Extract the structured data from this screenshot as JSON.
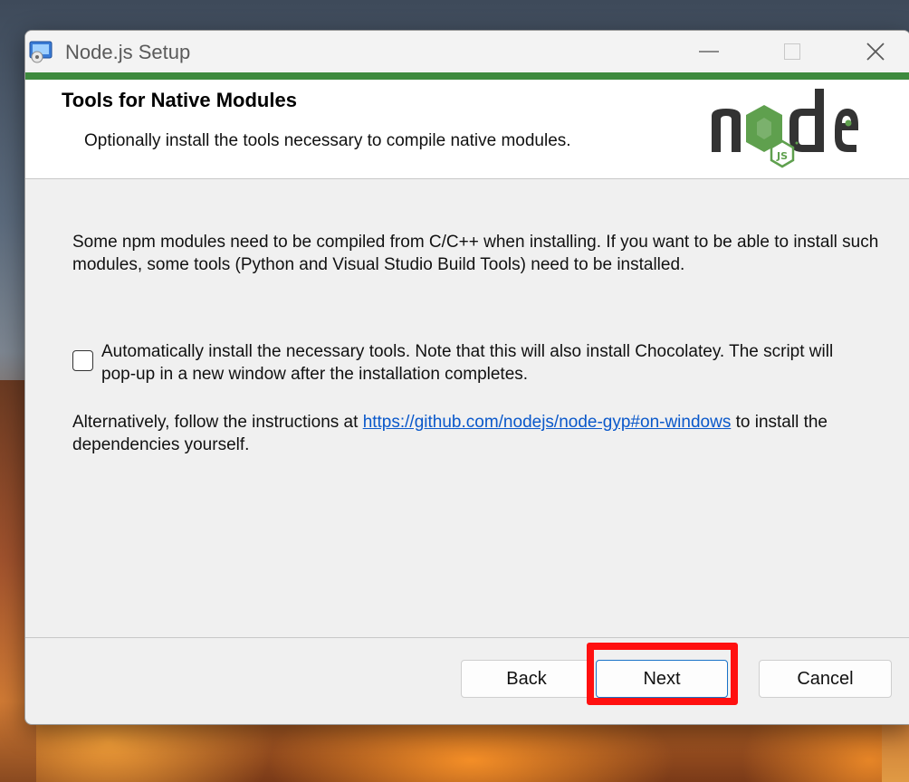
{
  "window": {
    "title": "Node.js Setup"
  },
  "header": {
    "title": "Tools for Native Modules",
    "subtitle": "Optionally install the tools necessary to compile native modules."
  },
  "body": {
    "paragraph1": "Some npm modules need to be compiled from C/C++ when installing. If you want to be able to install such modules, some tools (Python and Visual Studio Build Tools) need to be installed.",
    "checkbox_label": "Automatically install the necessary tools. Note that this will also install Chocolatey. The script will pop-up in a new window after the installation completes.",
    "checkbox_checked": false,
    "alt_prefix": "Alternatively, follow the instructions at ",
    "alt_link": "https://github.com/nodejs/node-gyp#on-windows",
    "alt_suffix": " to install the dependencies yourself."
  },
  "buttons": {
    "back": "Back",
    "next": "Next",
    "cancel": "Cancel"
  },
  "colors": {
    "accent_green": "#3e8a3e",
    "highlight_red": "#ff1010",
    "link_blue": "#0a58ca"
  }
}
